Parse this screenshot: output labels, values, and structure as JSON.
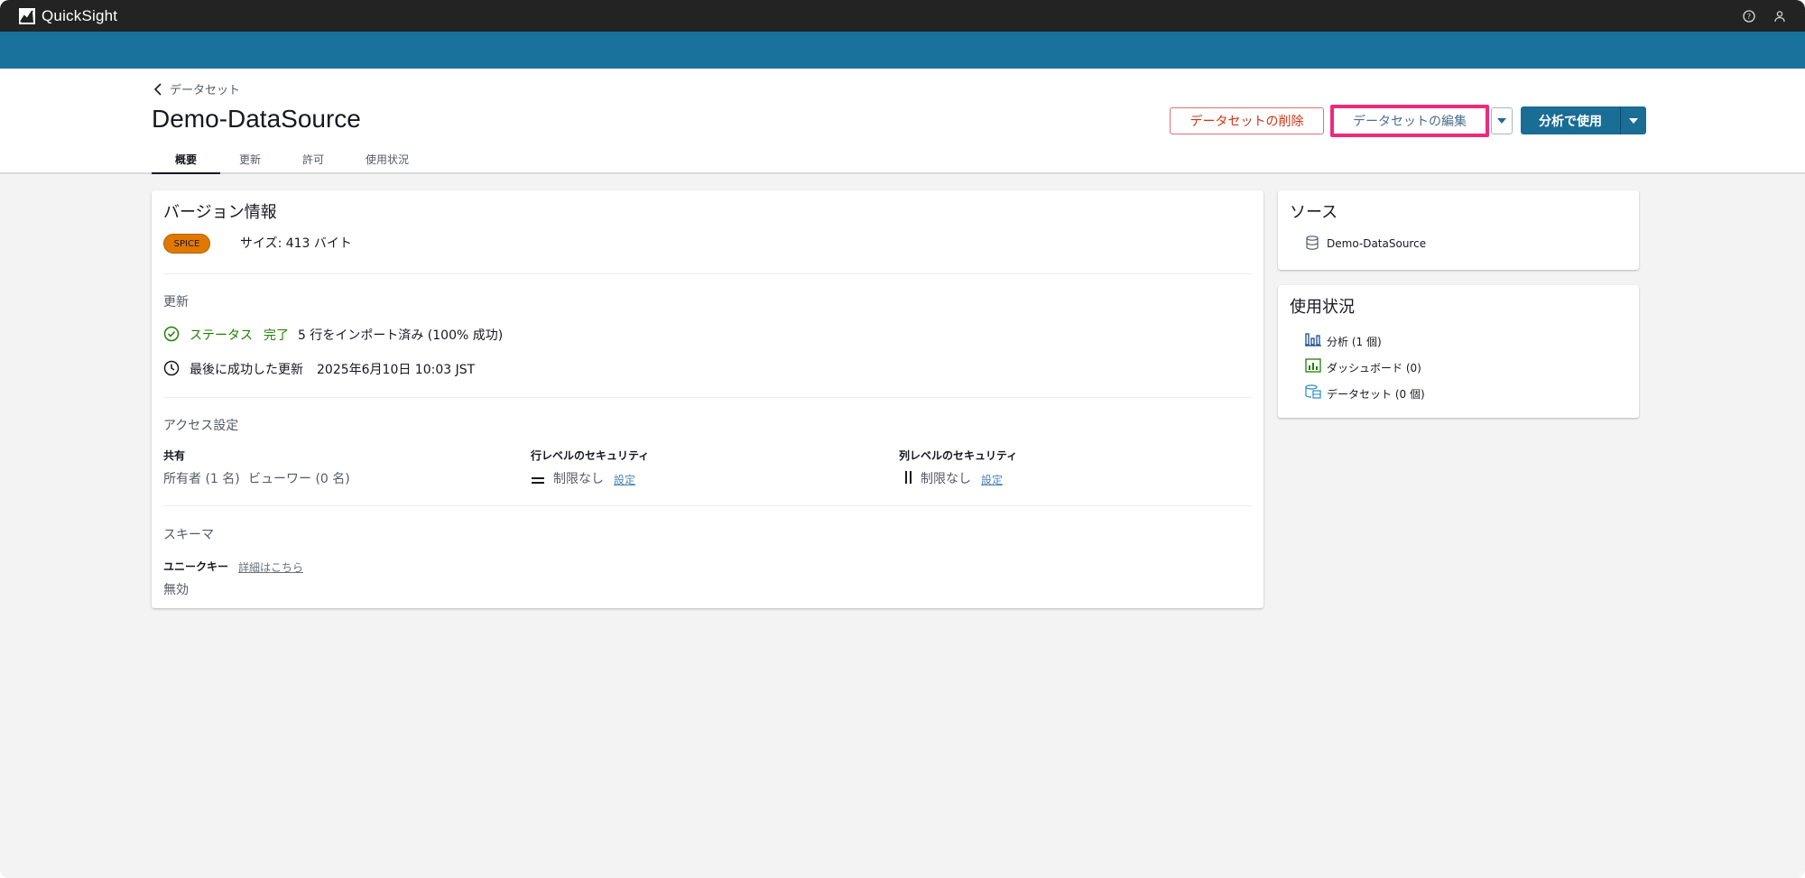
{
  "app": {
    "name": "QuickSight"
  },
  "header": {
    "breadcrumb": "データセット",
    "title": "Demo-DataSource",
    "tabs": [
      {
        "label": "概要",
        "active": true
      },
      {
        "label": "更新",
        "active": false
      },
      {
        "label": "許可",
        "active": false
      },
      {
        "label": "使用状況",
        "active": false
      }
    ],
    "buttons": {
      "delete": "データセットの削除",
      "edit": "データセットの編集",
      "use": "分析で使用"
    }
  },
  "version": {
    "heading": "バージョン情報",
    "badge": "SPICE",
    "size": "サイズ: 413 バイト"
  },
  "refresh": {
    "heading": "更新",
    "status_label": "ステータス",
    "status_value": "完了",
    "import_text": "5 行をインポート済み (100% 成功)",
    "last_label": "最後に成功した更新",
    "last_value": "2025年6月10日 10:03 JST"
  },
  "access": {
    "heading": "アクセス設定",
    "sharing_label": "共有",
    "sharing_owner": "所有者 (1 名)",
    "sharing_viewer": "ビューワー (0 名)",
    "rls_label": "行レベルのセキュリティ",
    "rls_value": "制限なし",
    "rls_link": "設定",
    "cls_label": "列レベルのセキュリティ",
    "cls_value": "制限なし",
    "cls_link": "設定"
  },
  "schema": {
    "heading": "スキーマ",
    "unique_key_label": "ユニークキー",
    "learn_more": "詳細はこちら",
    "unique_key_value": "無効"
  },
  "source": {
    "heading": "ソース",
    "item": "Demo-DataSource"
  },
  "usage": {
    "heading": "使用状況",
    "items": [
      {
        "label": "分析 (1 個)",
        "icon": "bar-chart-icon"
      },
      {
        "label": "ダッシュボード (0)",
        "icon": "dashboard-icon"
      },
      {
        "label": "データセット (0 個)",
        "icon": "dataset-icon"
      }
    ]
  },
  "colors": {
    "topbar": "#232323",
    "accent_bar": "#18729b",
    "primary_button": "#1a6d95",
    "highlight": "#ed2a7b",
    "success": "#1d8102",
    "badge": "#e07800"
  }
}
